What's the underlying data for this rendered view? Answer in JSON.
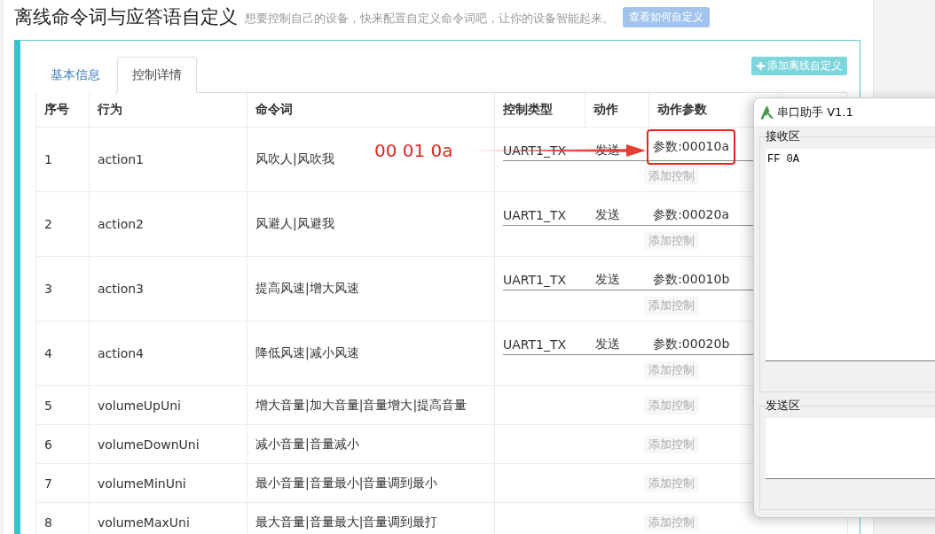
{
  "header": {
    "title": "离线命令词与应答语自定义",
    "subtitle": "想要控制自己的设备，快来配置自定义命令词吧，让你的设备智能起来。",
    "help_button": "查看如何自定义"
  },
  "tabs": [
    {
      "label": "基本信息",
      "selected": false
    },
    {
      "label": "控制详情",
      "selected": true
    }
  ],
  "add_button": {
    "label": "添加离线自定义"
  },
  "table": {
    "columns": [
      "序号",
      "行为",
      "命令词",
      "控制类型",
      "动作",
      "动作参数"
    ],
    "rows": [
      {
        "index": "1",
        "behavior": "action1",
        "command_words": "风吹人|风吹我",
        "controls": [
          {
            "type": "UART1_TX",
            "action": "发送",
            "param": "参数:00010a",
            "highlighted": true
          }
        ],
        "add_control": "添加控制"
      },
      {
        "index": "2",
        "behavior": "action2",
        "command_words": "风避人|风避我",
        "controls": [
          {
            "type": "UART1_TX",
            "action": "发送",
            "param": "参数:00020a",
            "highlighted": false
          }
        ],
        "add_control": "添加控制"
      },
      {
        "index": "3",
        "behavior": "action3",
        "command_words": "提高风速|增大风速",
        "controls": [
          {
            "type": "UART1_TX",
            "action": "发送",
            "param": "参数:00010b",
            "highlighted": false
          }
        ],
        "add_control": "添加控制"
      },
      {
        "index": "4",
        "behavior": "action4",
        "command_words": "降低风速|减小风速",
        "controls": [
          {
            "type": "UART1_TX",
            "action": "发送",
            "param": "参数:00020b",
            "highlighted": false
          }
        ],
        "add_control": "添加控制"
      },
      {
        "index": "5",
        "behavior": "volumeUpUni",
        "command_words": "增大音量|加大音量|音量增大|提高音量",
        "add_control": "添加控制"
      },
      {
        "index": "6",
        "behavior": "volumeDownUni",
        "command_words": "减小音量|音量减小",
        "add_control": "添加控制"
      },
      {
        "index": "7",
        "behavior": "volumeMinUni",
        "command_words": "最小音量|音量最小|音量调到最小",
        "add_control": "添加控制"
      },
      {
        "index": "8",
        "behavior": "volumeMaxUni",
        "command_words": "最大音量|音量最大|音量调到最打",
        "add_control": "添加控制"
      }
    ]
  },
  "annotation": {
    "text": "00 01 0a"
  },
  "serial_window": {
    "title": "串口助手 V1.1",
    "receive": {
      "label": "接收区",
      "value": "FF 0A"
    },
    "send": {
      "label": "发送区"
    }
  }
}
